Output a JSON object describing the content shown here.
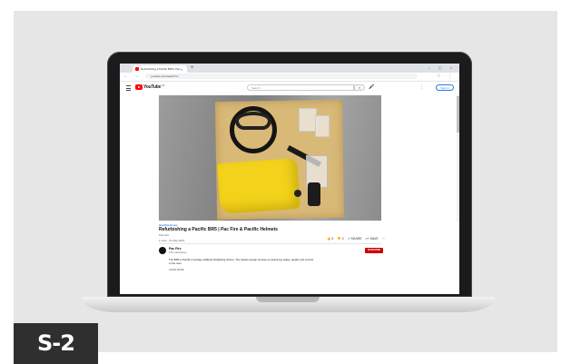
{
  "badge": {
    "label": "S-2"
  },
  "browser": {
    "tab_title": "Refurbishing a Pacific BR5 | Pac...",
    "tab_close": "×",
    "new_tab": "+",
    "window_controls": "–  ▢  ×",
    "url": "youtube.com/watch?v=",
    "nav": "←  →  ⟳",
    "addr_icons": "☆  ⋮"
  },
  "youtube": {
    "logo_text": "YouTube",
    "logo_region": "NZ",
    "search_placeholder": "Search",
    "search_icon": "⌕",
    "mic_icon": "🎤",
    "header_icons": "⋮",
    "sign_in": "Sign in"
  },
  "video": {
    "hashtag": "#pacifichelmets",
    "title": "Refurbishing a Pacific BR5 | Pac Fire & Pacific Helmets",
    "meta": "Pac Fire",
    "views": "1 view · 21 May 2021",
    "actions": {
      "like": "👍 0",
      "dislike": "👎 0",
      "share": "↗ SHARE",
      "save": "≡+ SAVE",
      "more": "⋯"
    }
  },
  "channel": {
    "name": "Pac Fire",
    "subscribers": "135 subscribers",
    "subscribe_label": "SUBSCRIBE",
    "description": "The BR5 is Pacific's heritage wildland firefighting helmet. The classic design focuses on delivering safety, quality and comfort to the user.",
    "show_more": "SHOW MORE"
  },
  "colors": {
    "youtube_red": "#ff0000",
    "subscribe_red": "#cc0000",
    "link_blue": "#065fd4",
    "badge_bg": "#2f2f2f"
  }
}
